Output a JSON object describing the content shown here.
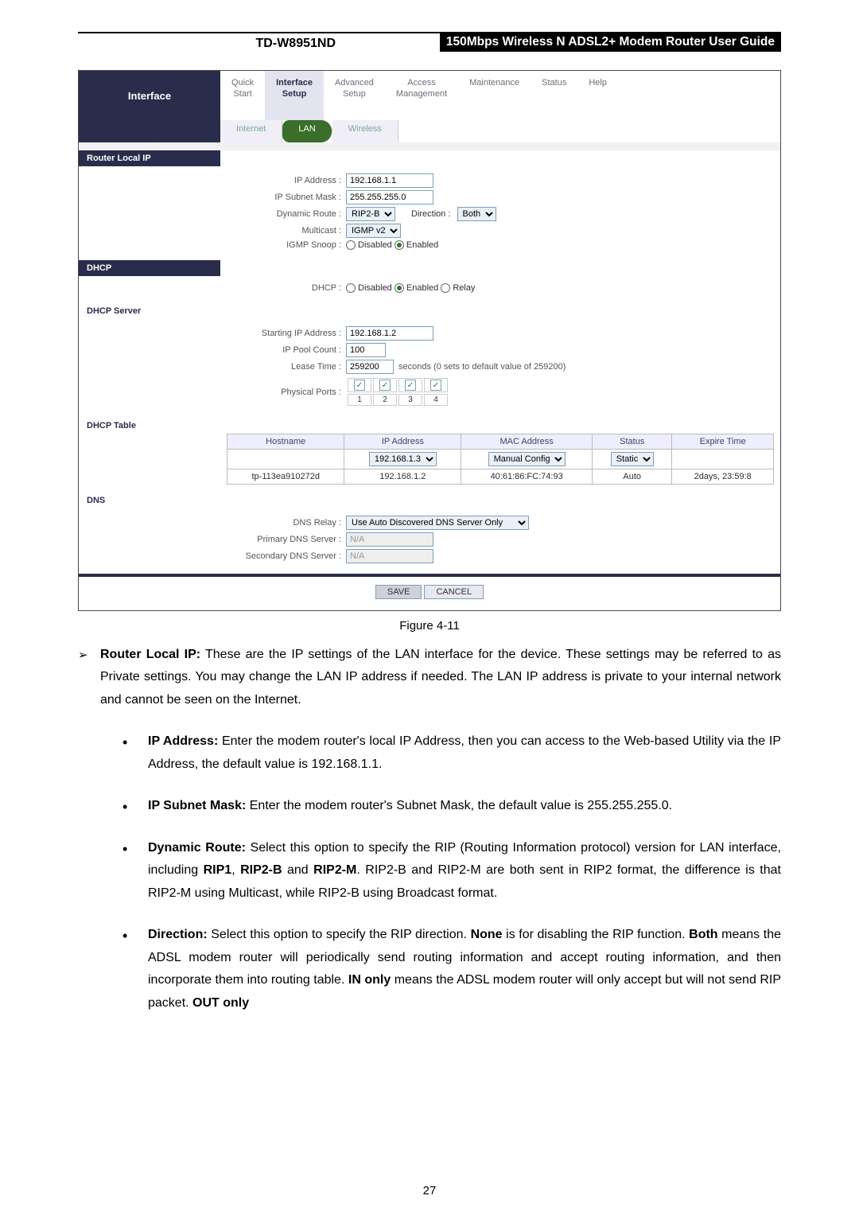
{
  "header": {
    "model": "TD-W8951ND",
    "title": "150Mbps Wireless N ADSL2+ Modem Router User Guide"
  },
  "navleft": "Interface",
  "tabs": {
    "quick": {
      "l1": "Quick",
      "l2": "Start"
    },
    "interface": {
      "l1": "Interface",
      "l2": "Setup"
    },
    "advanced": {
      "l1": "Advanced",
      "l2": "Setup"
    },
    "access": {
      "l1": "Access",
      "l2": "Management"
    },
    "maintenance": {
      "l1": "Maintenance",
      "l2": ""
    },
    "status": {
      "l1": "Status",
      "l2": ""
    },
    "help": {
      "l1": "Help",
      "l2": ""
    }
  },
  "subtabs": {
    "internet": "Internet",
    "lan": "LAN",
    "wireless": "Wireless"
  },
  "sections": {
    "routerlocalip": "Router Local IP",
    "dhcp": "DHCP",
    "dhcpserver": "DHCP Server",
    "dhcptable": "DHCP Table",
    "dns": "DNS"
  },
  "labels": {
    "ipaddress": "IP Address :",
    "subnet": "IP Subnet Mask :",
    "dynroute": "Dynamic Route :",
    "direction": "Direction :",
    "multicast": "Multicast :",
    "igmpsnoop": "IGMP Snoop :",
    "dhcp": "DHCP :",
    "startip": "Starting IP Address :",
    "poolcount": "IP Pool Count :",
    "leasetime": "Lease Time :",
    "leasenote": "seconds   (0 sets to default value of 259200)",
    "physports": "Physical Ports :",
    "dnsrelay": "DNS Relay :",
    "primarydns": "Primary DNS Server :",
    "secondarydns": "Secondary DNS Server :"
  },
  "values": {
    "ipaddress": "192.168.1.1",
    "subnet": "255.255.255.0",
    "dynroute": "RIP2-B",
    "direction": "Both",
    "multicast": "IGMP v2",
    "disabled": "Disabled",
    "enabled": "Enabled",
    "relay": "Relay",
    "startip": "192.168.1.2",
    "poolcount": "100",
    "leasetime": "259200",
    "dnsrelay": "Use Auto Discovered DNS Server Only",
    "na": "N/A"
  },
  "ports": [
    "1",
    "2",
    "3",
    "4"
  ],
  "dhcp_table": {
    "headers": {
      "host": "Hostname",
      "ip": "IP Address",
      "mac": "MAC Address",
      "status": "Status",
      "expire": "Expire Time"
    },
    "row_input": {
      "ip": "192.168.1.3",
      "maccfg": "Manual Config",
      "status": "Static"
    },
    "row2": {
      "host": "tp-113ea910272d",
      "ip": "192.168.1.2",
      "mac": "40:61:86:FC:74:93",
      "status": "Auto",
      "expire": "2days, 23:59:8"
    }
  },
  "buttons": {
    "save": "SAVE",
    "cancel": "CANCEL"
  },
  "figcap": "Figure 4-11",
  "body": {
    "routerlocalip_lead": "Router Local IP:",
    "routerlocalip_text": " These are the IP settings of the LAN interface for the device. These settings may be referred to as Private settings. You may change the LAN IP address if needed. The LAN IP address is private to your internal network and cannot be seen on the Internet.",
    "ipaddr_lead": "IP Address:",
    "ipaddr_text": " Enter the modem router's local IP Address, then you can access to the Web-based Utility via the IP Address, the default value is 192.168.1.1.",
    "subnet_lead": "IP Subnet Mask:",
    "subnet_text": " Enter the modem router's Subnet Mask, the default value is 255.255.255.0.",
    "dynroute_lead": "Dynamic Route:",
    "dynroute_text": " Select this option to specify the RIP (Routing Information protocol) version for LAN interface, including ",
    "rip1": "RIP1",
    "comma": ", ",
    "rip2b": "RIP2-B",
    "and": " and ",
    "rip2m": "RIP2-M",
    "dynroute_tail": ". RIP2-B and RIP2-M are both sent in RIP2 format, the difference is that RIP2-M using Multicast, while RIP2-B using Broadcast format.",
    "direction_lead": "Direction:",
    "direction_text": " Select this option to specify the RIP direction. ",
    "none": "None",
    "direction_t2": " is for disabling the RIP function. ",
    "both": "Both",
    "direction_t3": " means the ADSL modem router will periodically send routing information and accept routing information, and then incorporate them into routing table. ",
    "inonly": "IN only",
    "direction_t4": " means the ADSL modem router will only accept but will not send RIP packet. ",
    "outonly": "OUT only"
  },
  "page_number": "27"
}
